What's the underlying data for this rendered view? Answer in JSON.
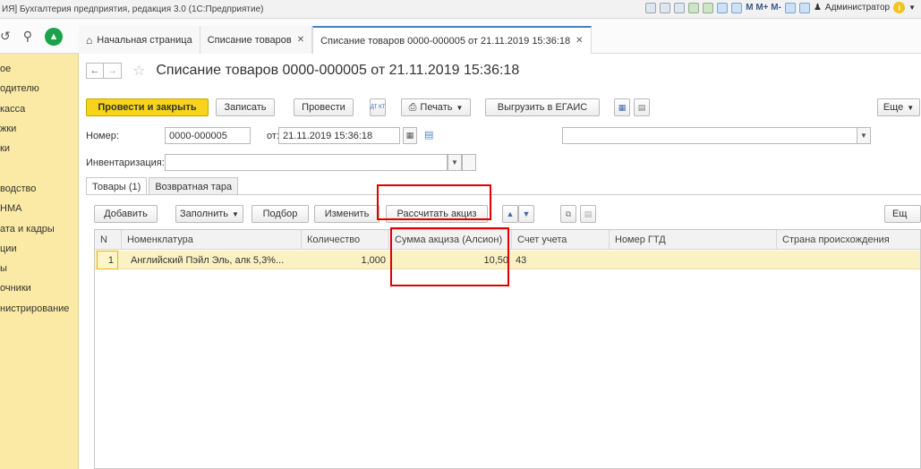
{
  "window": {
    "title": "ИЯ] Бухгалтерия предприятия, редакция 3.0 (1С:Предприятие)",
    "toolbar_text": "M M+ M-",
    "user": "Администратор"
  },
  "nav": {
    "tabs": [
      {
        "label": "Начальная страница",
        "closable": false
      },
      {
        "label": "Списание товаров",
        "closable": true
      },
      {
        "label": "Списание товаров 0000-000005 от 21.11.2019 15:36:18",
        "closable": true
      }
    ]
  },
  "sidebar": {
    "items": [
      "ое",
      "одителю",
      "касса",
      "жки",
      "ки",
      "",
      "водство",
      "НМА",
      "ата и кадры",
      "ции",
      "ы",
      "очники",
      "нистрирование"
    ]
  },
  "form": {
    "title": "Списание товаров 0000-000005 от 21.11.2019 15:36:18",
    "toolbar": {
      "post_close": "Провести и закрыть",
      "save": "Записать",
      "post": "Провести",
      "dtkt": "ДТ КТ",
      "print": "Печать",
      "egais": "Выгрузить в ЕГАИС",
      "more": "Еще"
    },
    "number_label": "Номер:",
    "number_value": "0000-000005",
    "date_label": "от:",
    "date_value": "21.11.2019 15:36:18",
    "inventory_label": "Инвентаризация:",
    "inventory_value": "",
    "subtabs": [
      "Товары (1)",
      "Возвратная тара"
    ],
    "table_toolbar": {
      "add": "Добавить",
      "fill": "Заполнить",
      "select": "Подбор",
      "change": "Изменить",
      "calc_excise": "Рассчитать акциз",
      "more": "Ещ"
    },
    "table": {
      "columns": [
        "N",
        "Номенклатура",
        "Количество",
        "Сумма акциза (Алсион)",
        "Счет учета",
        "Номер ГТД",
        "Страна происхождения"
      ],
      "rows": [
        [
          "1",
          "Английский Пэйл Эль, алк 5,3%...",
          "1,000",
          "10,50",
          "43",
          "",
          ""
        ]
      ]
    }
  }
}
